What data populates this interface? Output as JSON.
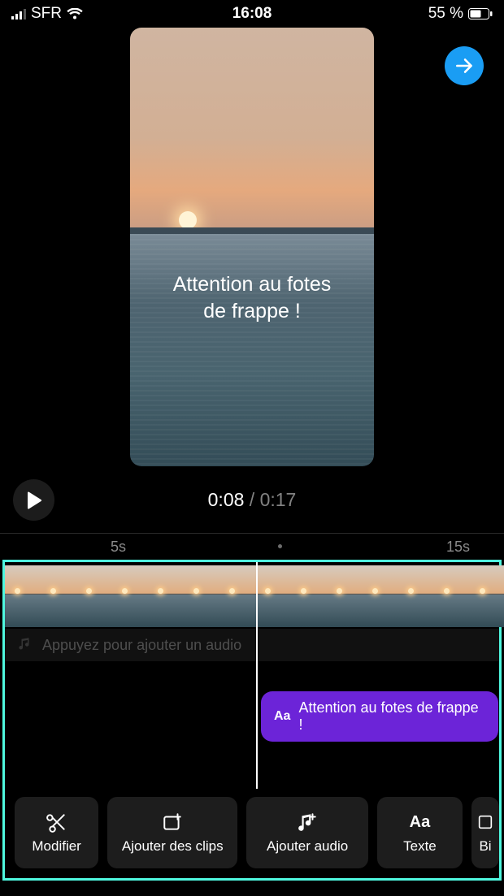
{
  "status": {
    "carrier": "SFR",
    "time": "16:08",
    "battery": "55 %"
  },
  "preview": {
    "caption_line1": "Attention au fotes",
    "caption_line2": "de frappe !"
  },
  "playback": {
    "current": "0:08",
    "separator": " / ",
    "total": "0:17"
  },
  "ruler": {
    "mark_5s": "5s",
    "mark_15s": "15s"
  },
  "tracks": {
    "audio_hint": "Appuyez pour ajouter un audio",
    "text_clip": {
      "prefix": "Aa",
      "label": "Attention au fotes  de frappe !"
    }
  },
  "toolbar": {
    "modify": "Modifier",
    "add_clips": "Ajouter des clips",
    "add_audio": "Ajouter audio",
    "text": "Texte",
    "extra": "Bi"
  }
}
